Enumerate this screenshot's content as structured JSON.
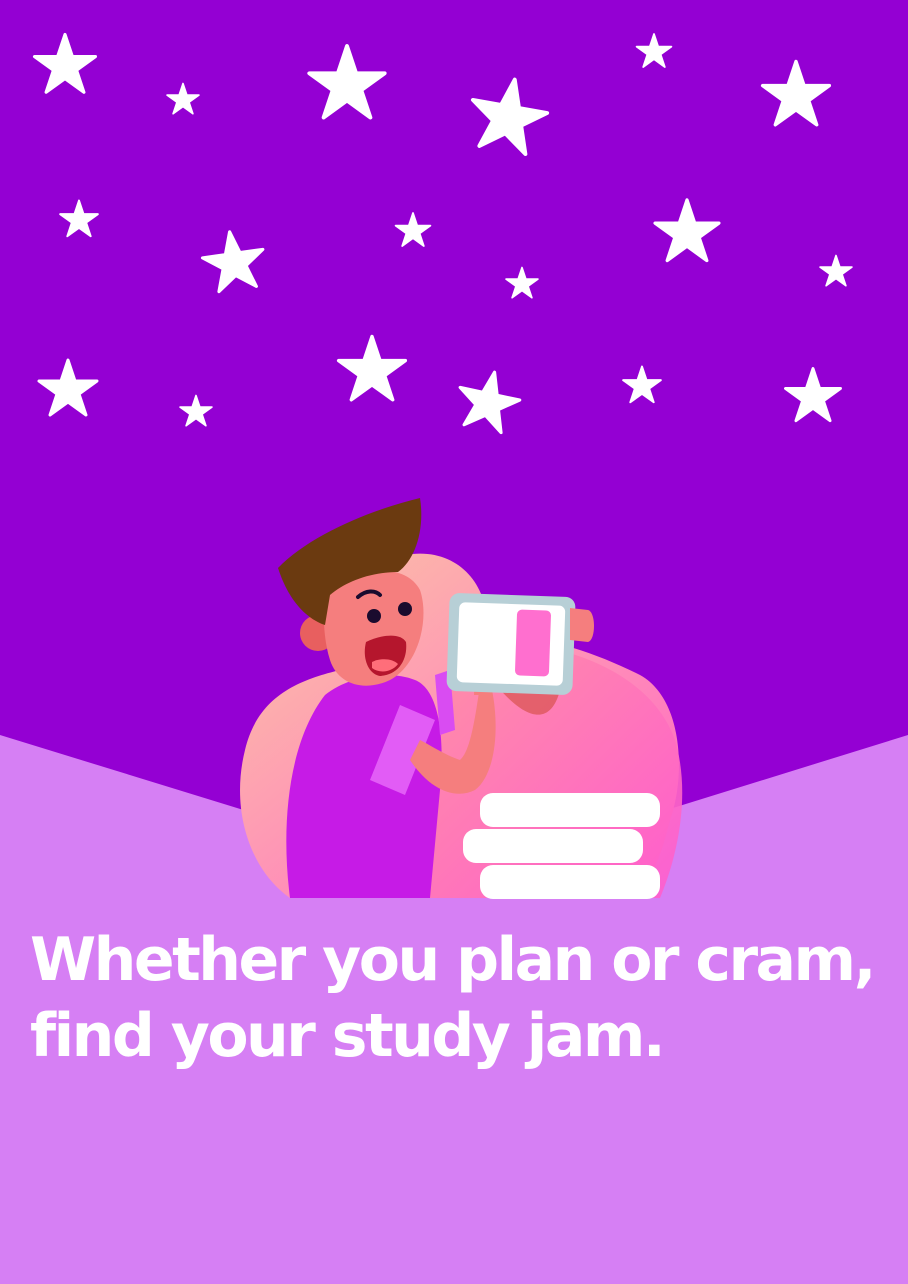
{
  "headline": {
    "line1": "Whether you plan or cram,",
    "line2": "find your study jam."
  },
  "colors": {
    "sky": "#9400d3",
    "ground": "#d67ff4",
    "star": "#ffffff",
    "shirt": "#c61be6",
    "skin": "#f57e7e",
    "hair": "#6b3a10",
    "blob_peach": "#f9b1a0",
    "blob_pink": "#ff6fc8",
    "tablet_frame": "#b7cfd6",
    "tablet_screen": "#ff6fcf"
  },
  "icons": [
    "star-icon",
    "person-with-tablet-illustration",
    "book-stack-icon"
  ]
}
